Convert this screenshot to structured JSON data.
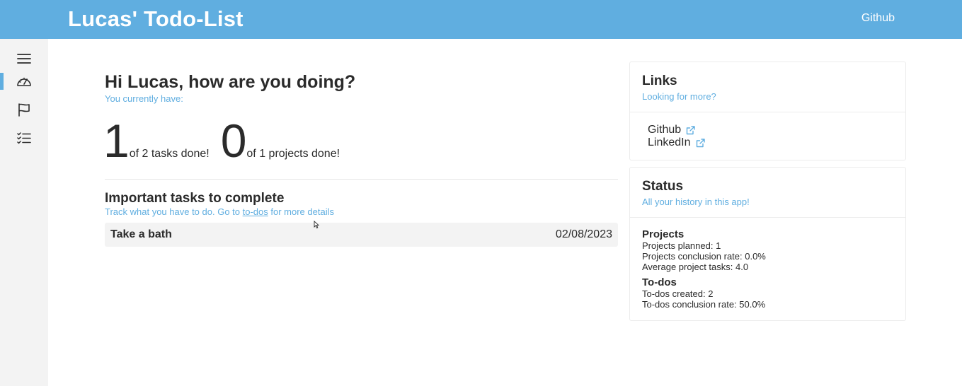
{
  "header": {
    "title": "Lucas' Todo-List",
    "github_link": "Github"
  },
  "sidebar": {
    "items": [
      "menu-icon",
      "dashboard-icon",
      "flag-icon",
      "checklist-icon"
    ],
    "active_index": 1
  },
  "main": {
    "greeting": "Hi Lucas, how are you doing?",
    "subtitle": "You currently have:",
    "tasks_done": "1",
    "tasks_text": "of 2 tasks done!",
    "projects_done": "0",
    "projects_text": "of 1 projects done!",
    "important_title": "Important tasks to complete",
    "track_prefix": "Track what you have to do. Go to ",
    "track_link": "to-dos",
    "track_suffix": " for more details",
    "tasks": [
      {
        "name": "Take a bath",
        "date": "02/08/2023"
      }
    ]
  },
  "links_card": {
    "title": "Links",
    "subtitle": "Looking for more?",
    "links": [
      "Github",
      "LinkedIn"
    ]
  },
  "status_card": {
    "title": "Status",
    "subtitle": "All your history in this app!",
    "projects_title": "Projects",
    "projects_lines": [
      "Projects planned: 1",
      "Projects conclusion rate: 0.0%",
      "Average project tasks: 4.0"
    ],
    "todos_title": "To-dos",
    "todos_lines": [
      "To-dos created: 2",
      "To-dos conclusion rate: 50.0%"
    ]
  },
  "colors": {
    "accent": "#60aee0",
    "sidebar_bg": "#f3f3f3",
    "text": "#2b2b2b"
  }
}
